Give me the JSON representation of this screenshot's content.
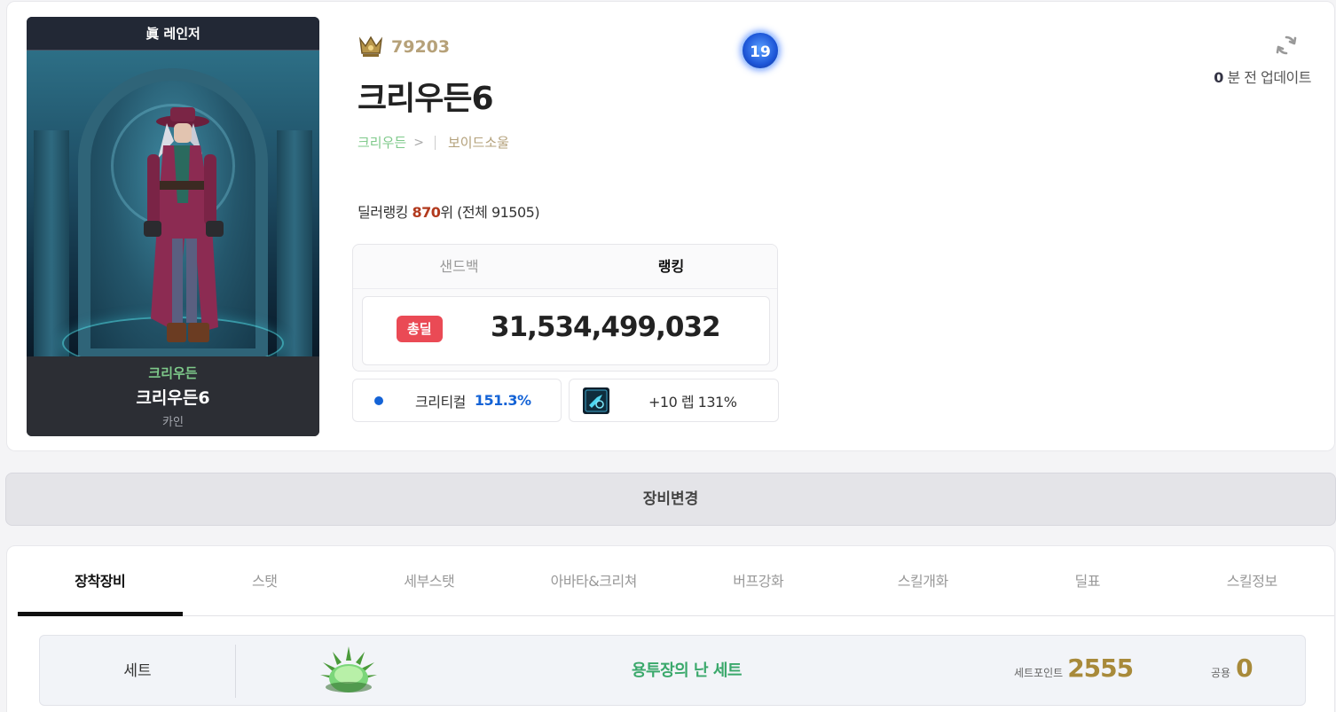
{
  "character": {
    "class_title": "眞 레인저",
    "server": "크리우든",
    "name": "크리우든6",
    "job": "카인",
    "fame": "79203",
    "level_badge": "19",
    "guild": "보이드소울"
  },
  "ranking": {
    "prefix": "딜러랭킹 ",
    "rank": "870",
    "suffix": "위 (전체 91505)"
  },
  "update": {
    "minutes": "0",
    "text": "분 전 업데이트"
  },
  "damage": {
    "tabs": [
      {
        "label": "샌드백",
        "active": false
      },
      {
        "label": "랭킹",
        "active": true
      }
    ],
    "pill": "총딜",
    "value": "31,534,499,032"
  },
  "stats": {
    "crit_label": "크리티컬",
    "crit_value": "151.3%",
    "skill_text": "+10 렙 131%"
  },
  "change_equipment": "장비변경",
  "tabs": [
    {
      "label": "장착장비",
      "active": true
    },
    {
      "label": "스탯",
      "active": false
    },
    {
      "label": "세부스탯",
      "active": false
    },
    {
      "label": "아바타&크리쳐",
      "active": false
    },
    {
      "label": "버프강화",
      "active": false
    },
    {
      "label": "스킬개화",
      "active": false
    },
    {
      "label": "딜표",
      "active": false
    },
    {
      "label": "스킬정보",
      "active": false
    }
  ],
  "set": {
    "label": "세트",
    "name": "용투장의 난 세트",
    "point_label": "세트포인트",
    "point_value": "2555",
    "common_label": "공용",
    "common_value": "0"
  },
  "colors": {
    "accent_green": "#7ec98a",
    "rank_red": "#b23a1e",
    "crit_blue": "#1463d6",
    "pill_red": "#ea4a55",
    "gold": "#a88a3a"
  }
}
